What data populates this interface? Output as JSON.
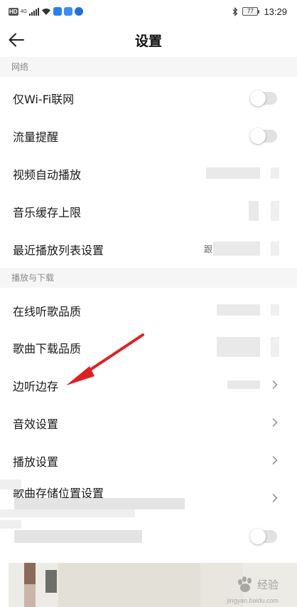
{
  "status_bar": {
    "network_badge": "HD",
    "network_type": "4G",
    "time": "13:29",
    "battery": "77"
  },
  "header": {
    "title": "设置"
  },
  "sections": [
    {
      "label": "网络",
      "rows": [
        {
          "label": "仅Wi-Fi联网",
          "control": "toggle",
          "on": false
        },
        {
          "label": "流量提醒",
          "control": "toggle",
          "on": false
        },
        {
          "label": "视频自动播放",
          "control": "value"
        },
        {
          "label": "音乐缓存上限",
          "control": "value"
        },
        {
          "label": "最近播放列表设置",
          "control": "value",
          "value_prefix": "跟"
        }
      ]
    },
    {
      "label": "播放与下载",
      "rows": [
        {
          "label": "在线听歌品质",
          "control": "value"
        },
        {
          "label": "歌曲下载品质",
          "control": "value"
        },
        {
          "label": "边听边存",
          "control": "chevron"
        },
        {
          "label": "音效设置",
          "control": "chevron"
        },
        {
          "label": "播放设置",
          "control": "chevron"
        },
        {
          "label": "歌曲存储位置设置",
          "control": "chevron"
        }
      ]
    }
  ],
  "watermark": {
    "text": "经验",
    "sub": "jingyan.baidu.com"
  },
  "annotation_color": "#e02020",
  "toggle_color": "#e2e2e2",
  "section_bg": "#f6f6f6"
}
